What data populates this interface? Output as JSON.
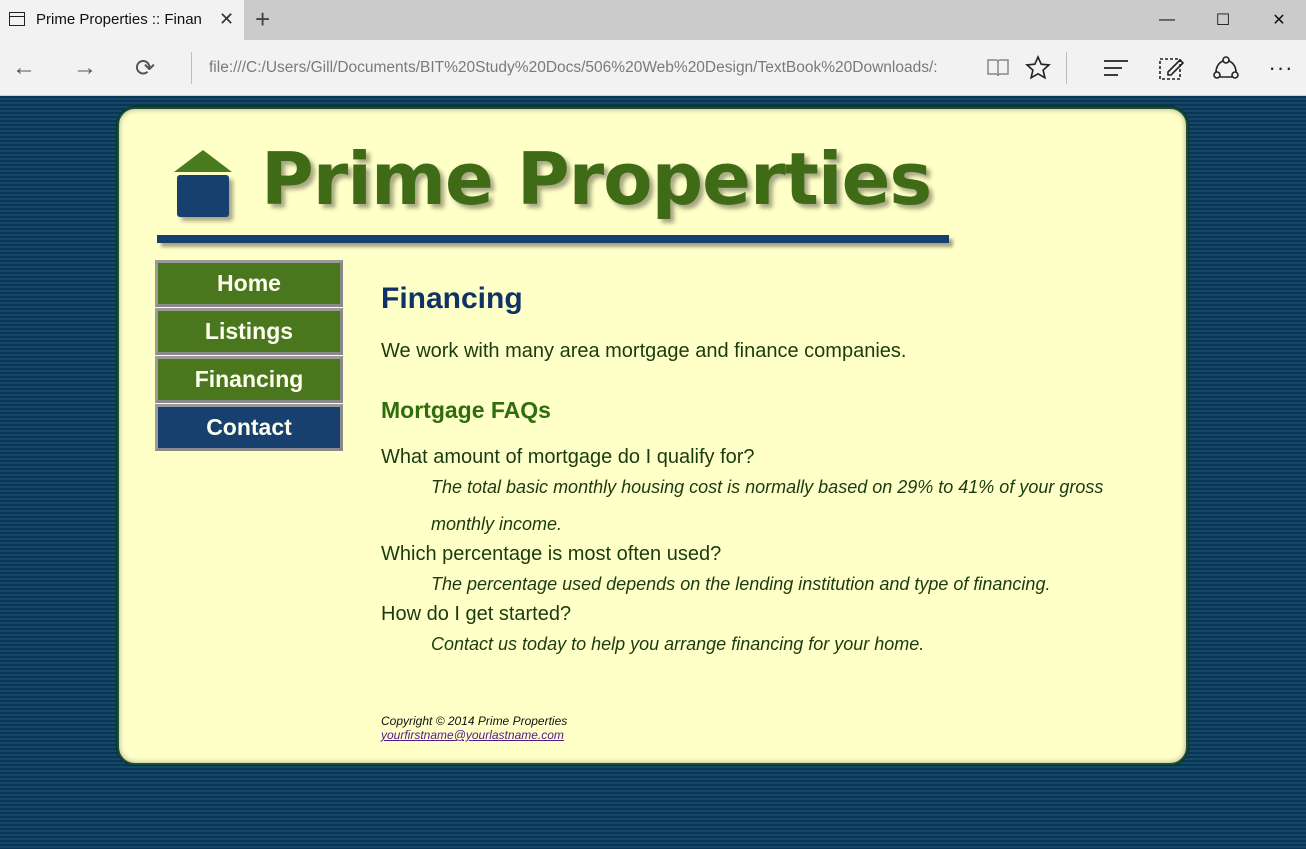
{
  "browser": {
    "tab_title": "Prime Properties :: Finan",
    "address": "file:///C:/Users/Gill/Documents/BIT%20Study%20Docs/506%20Web%20Design/TextBook%20Downloads/:"
  },
  "site": {
    "logo_text": "Prime Properties"
  },
  "menu": [
    {
      "label": "Home"
    },
    {
      "label": "Listings"
    },
    {
      "label": "Financing"
    },
    {
      "label": "Contact"
    }
  ],
  "main": {
    "heading": "Financing",
    "intro": "We work with many area mortgage and finance companies.",
    "subheading": "Mortgage FAQs",
    "faqs": [
      {
        "q": "What amount of mortgage do I qualify for?",
        "a": "The total basic monthly housing cost is normally based on 29% to 41% of your gross monthly income."
      },
      {
        "q": "Which percentage is most often used?",
        "a": "The percentage used depends on the lending institution and type of financing."
      },
      {
        "q": "How do I get started?",
        "a": "Contact us today to help you arrange financing for your home."
      }
    ]
  },
  "footer": {
    "copyright": "Copyright © 2014 Prime Properties",
    "email": "yourfirstname@yourlastname.com"
  },
  "colors": {
    "menu_green": "#4a771e",
    "menu_blue": "#17406e",
    "page_bg": "#ffffc8"
  }
}
